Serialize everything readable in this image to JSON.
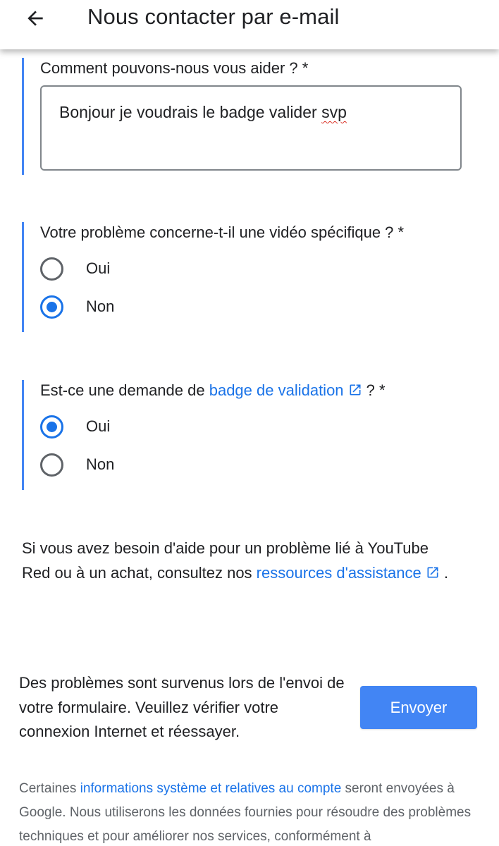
{
  "header": {
    "title": "Nous contacter par e-mail",
    "back_icon": "arrow-back-icon"
  },
  "question_help": {
    "label": "Comment pouvons-nous vous aider ? *",
    "value_before": "Bonjour je voudrais le badge valider ",
    "value_misspelled": "svp"
  },
  "question_video": {
    "label": "Votre problème concerne-t-il une vidéo spécifique ? *",
    "options": [
      {
        "label": "Oui",
        "checked": false
      },
      {
        "label": "Non",
        "checked": true
      }
    ]
  },
  "question_badge": {
    "label_prefix": "Est-ce une demande de ",
    "link_text": "badge de validation",
    "label_suffix": " ? *",
    "options": [
      {
        "label": "Oui",
        "checked": true
      },
      {
        "label": "Non",
        "checked": false
      }
    ]
  },
  "help_note": {
    "text_before": "Si vous avez besoin d'aide pour un problème lié à YouTube Red ou à un achat, consultez nos ",
    "link_text": "ressources d'assistance",
    "text_after": " ."
  },
  "error": {
    "message": "Des problèmes sont survenus lors de l'envoi de votre formulaire. Veuillez vérifier votre connexion Internet et réessayer."
  },
  "submit": {
    "label": "Envoyer"
  },
  "footer": {
    "text_before": "Certaines ",
    "link_text": "informations système et relatives au compte",
    "text_after": " seront envoyées à Google. Nous utiliserons les données fournies pour résoudre des problèmes techniques et pour améliorer nos services, conformément à"
  },
  "colors": {
    "accent": "#4285f4",
    "link": "#1a73e8",
    "text": "#202124",
    "muted": "#5f6368"
  }
}
